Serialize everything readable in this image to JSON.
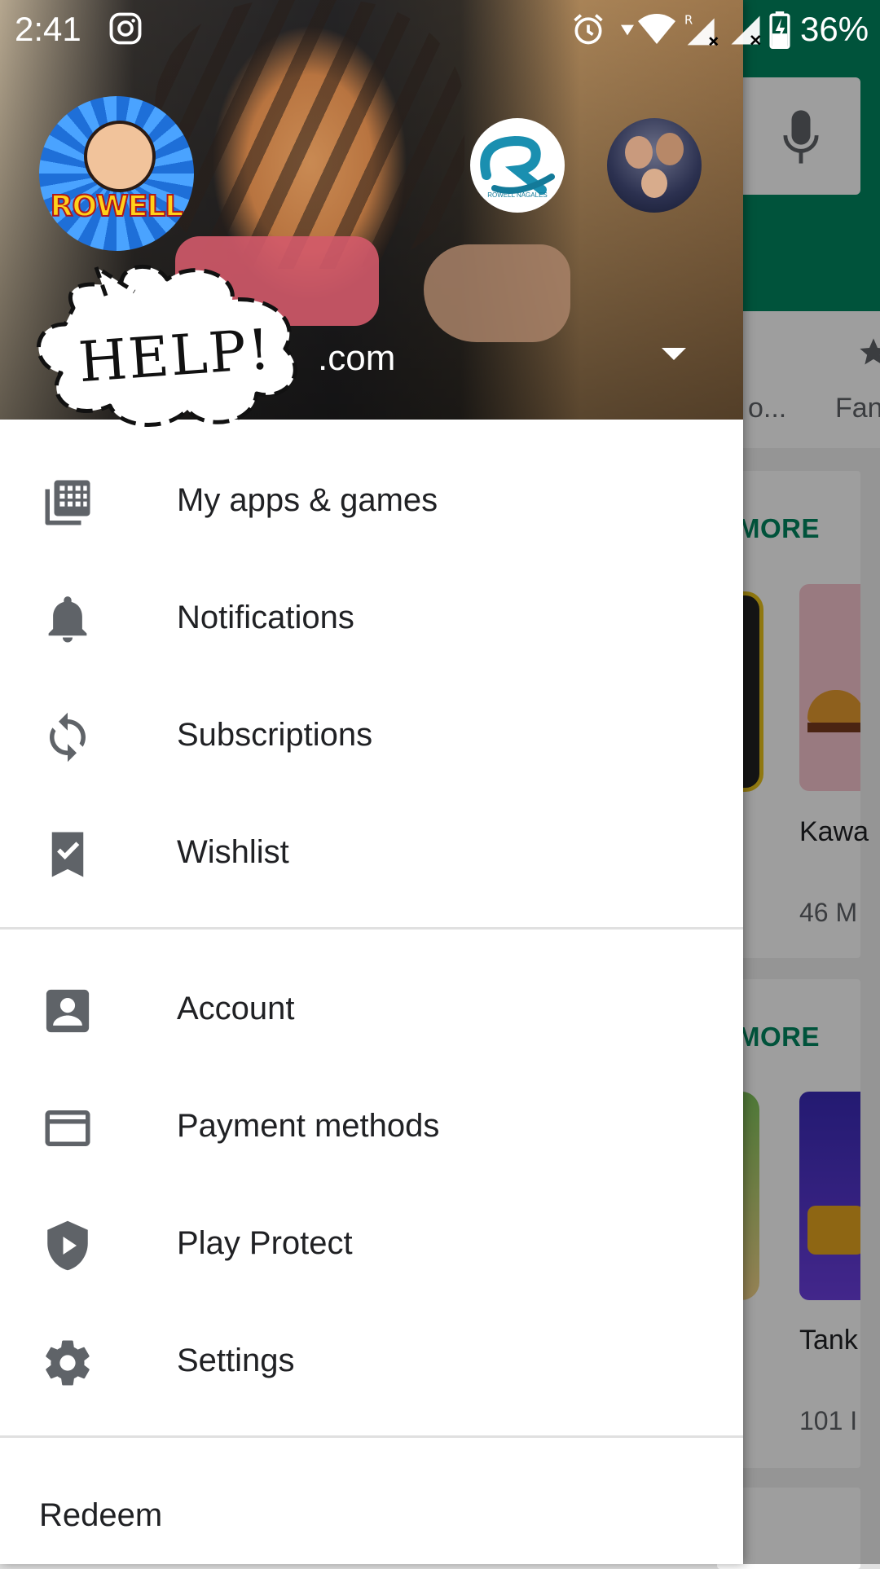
{
  "status_bar": {
    "time": "2:41",
    "battery_percent": "36%",
    "icons": [
      "instagram-icon",
      "alarm-icon",
      "wifi-icon",
      "signal-roaming-icon",
      "signal-icon",
      "battery-charging-icon"
    ]
  },
  "background": {
    "tab_partial_1": "o...",
    "tab_partial_2": "Fan",
    "more_label_1": "MORE",
    "more_label_2": "MORE",
    "app_1_name": "Kawa",
    "app_1_size": "46 M",
    "app_2_name": "Tank",
    "app_2_size": "101 I",
    "accent_color": "#01875f"
  },
  "drawer": {
    "header": {
      "email_visible": ".com",
      "avatar_main_text": "ROWELL",
      "avatar_alt_1_caption": "ROWELL NAGALES",
      "help_text": "HELP!"
    },
    "menu_section_1": [
      {
        "label": "My apps & games",
        "icon": "apps-grid-icon"
      },
      {
        "label": "Notifications",
        "icon": "bell-icon"
      },
      {
        "label": "Subscriptions",
        "icon": "refresh-icon"
      },
      {
        "label": "Wishlist",
        "icon": "bookmark-check-icon"
      }
    ],
    "menu_section_2": [
      {
        "label": "Account",
        "icon": "account-icon"
      },
      {
        "label": "Payment methods",
        "icon": "credit-card-icon"
      },
      {
        "label": "Play Protect",
        "icon": "shield-play-icon"
      },
      {
        "label": "Settings",
        "icon": "gear-icon"
      }
    ],
    "redeem": "Redeem"
  }
}
